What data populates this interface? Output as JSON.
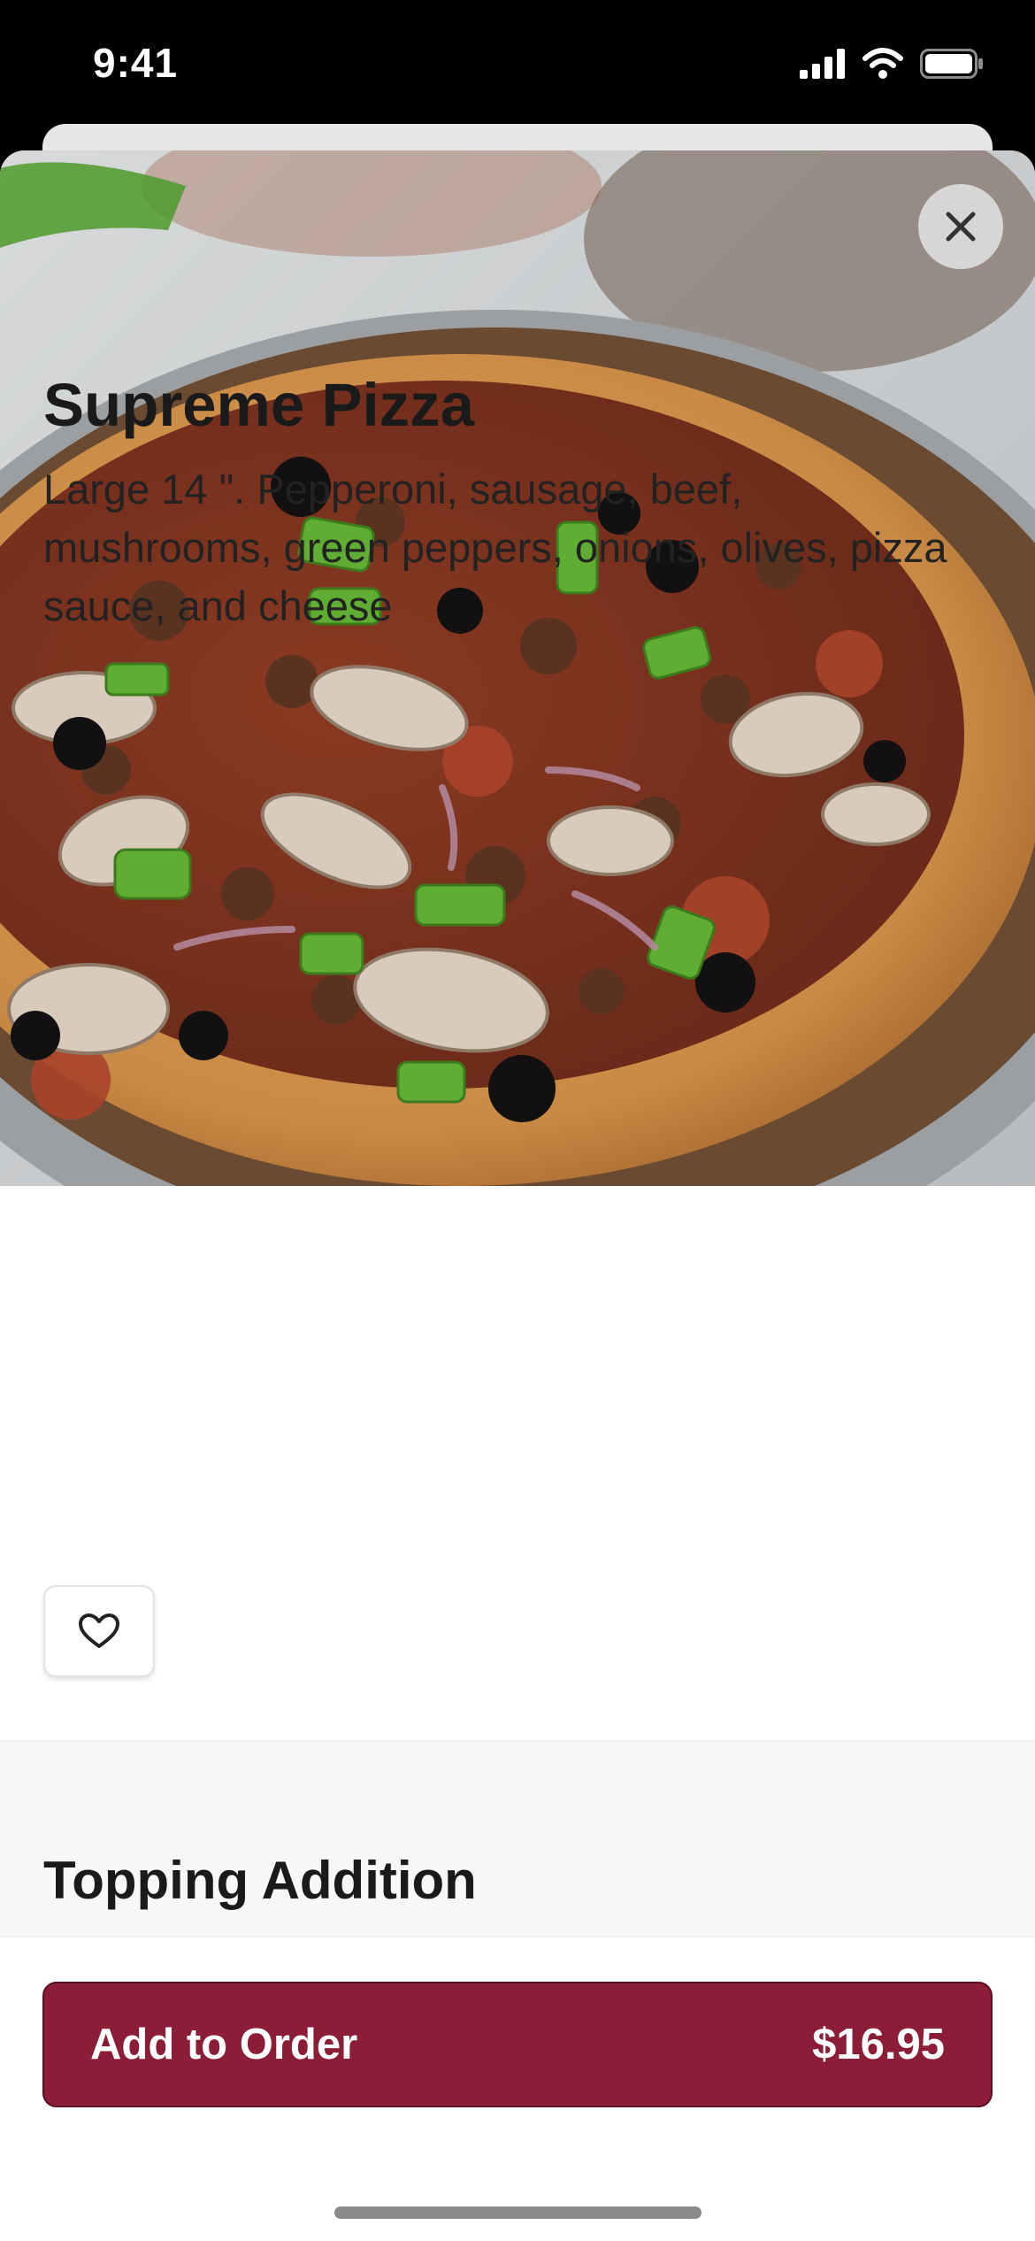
{
  "status_bar": {
    "time": "9:41",
    "icons": [
      "signal-icon",
      "wifi-icon",
      "battery-icon"
    ]
  },
  "item": {
    "image": "supreme-pizza-photo",
    "name": "Supreme Pizza",
    "description": "Large 14 \". Pepperoni, sausage, beef, mushrooms, green peppers, onions, olives, pizza sauce, and cheese"
  },
  "buttons": {
    "close_icon": "close-icon",
    "favorite_icon": "heart-icon"
  },
  "sections": [
    {
      "title": "Topping Addition"
    }
  ],
  "footer": {
    "add_label": "Add to Order",
    "price": "$16.95"
  },
  "colors": {
    "accent": "#8c1d36",
    "accent_border": "#5a0f22",
    "section_bg": "#f7f7f7"
  }
}
